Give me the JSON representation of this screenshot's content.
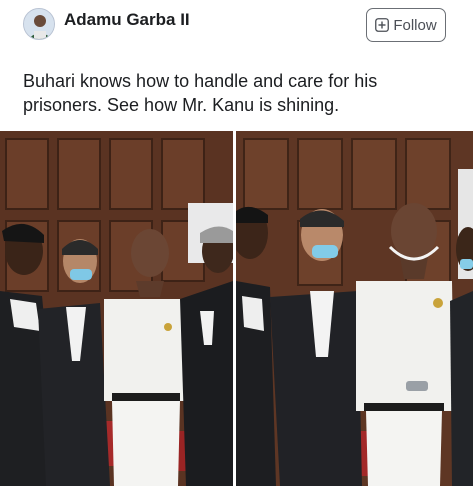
{
  "post": {
    "author_name": "Adamu Garba II",
    "follow_label": "Follow",
    "text_line1": "Buhari knows how to handle and care for his",
    "text_line2": "prisoners. See how Mr. Kanu is shining."
  },
  "icons": {
    "avatar": "user-avatar",
    "follow": "plus-in-square-icon"
  },
  "colors": {
    "wood_panel": "#5a3322",
    "robe_black": "#1e1f22",
    "white_outfit": "#f1f1ee",
    "text": "#1c1e21"
  }
}
